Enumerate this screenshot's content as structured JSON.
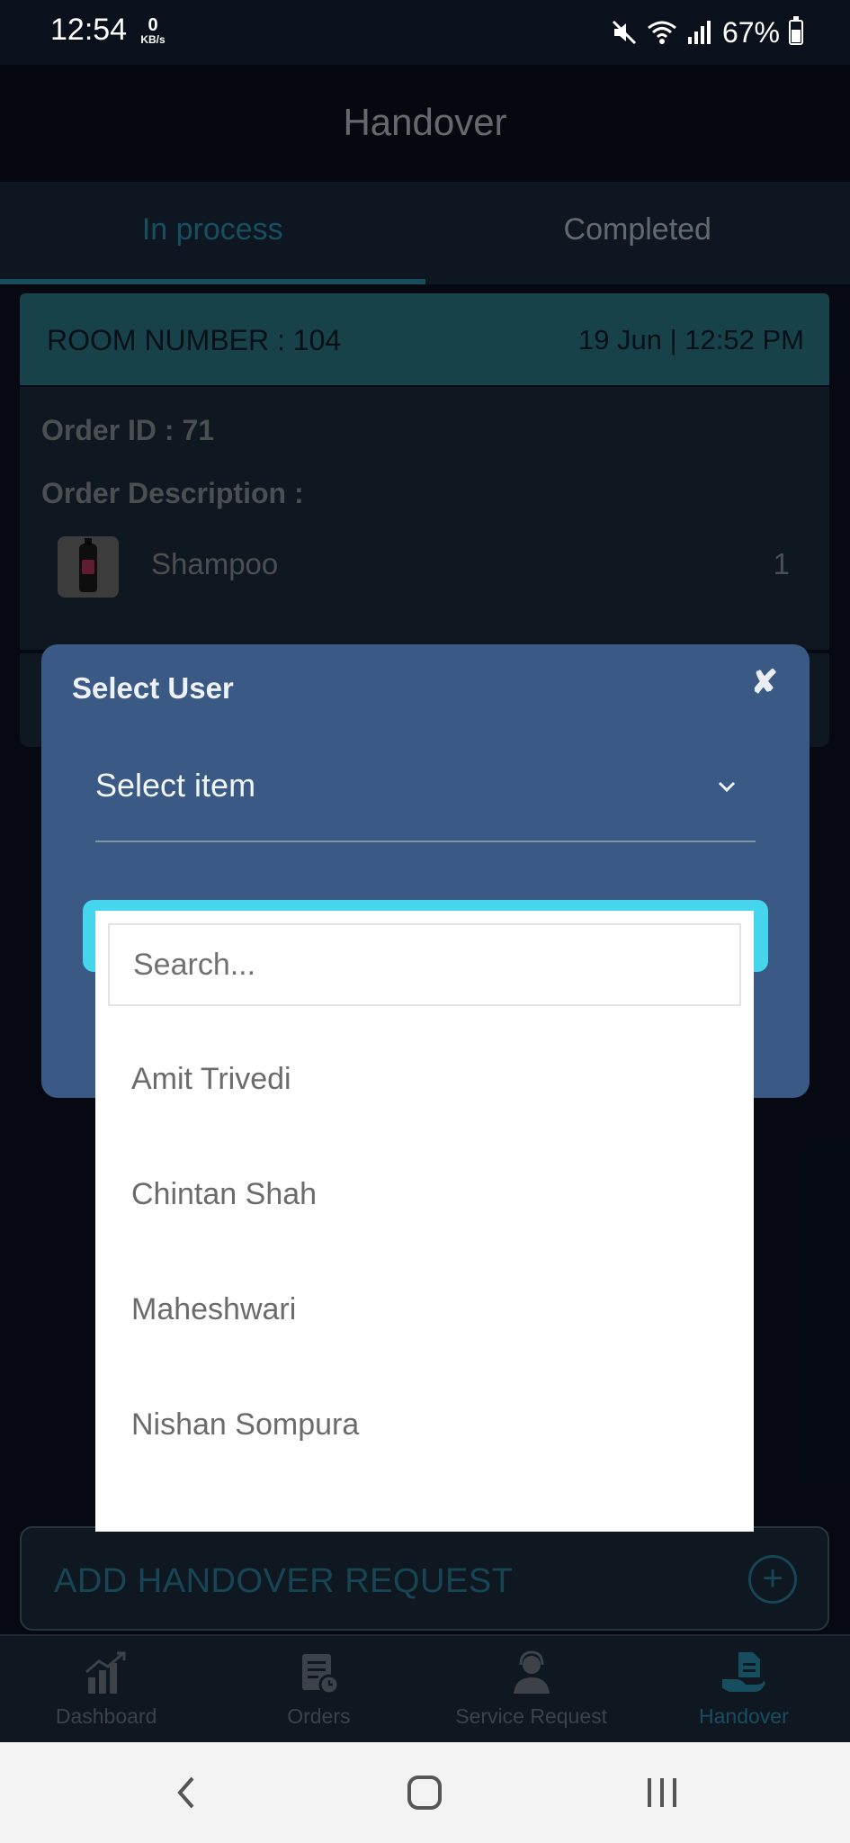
{
  "status_bar": {
    "time": "12:54",
    "net_speed_value": "0",
    "net_speed_unit": "KB/s",
    "battery_percent": "67%"
  },
  "header": {
    "title": "Handover"
  },
  "tabs": [
    {
      "label": "In process",
      "active": true
    },
    {
      "label": "Completed",
      "active": false
    }
  ],
  "card": {
    "room_number": "ROOM NUMBER : 104",
    "datetime": "19 Jun | 12:52 PM",
    "order_id": "Order ID : 71",
    "order_description_label": "Order Description :",
    "item_name": "Shampoo",
    "item_qty": "1"
  },
  "add_handover": {
    "label": "ADD HANDOVER REQUEST",
    "icon": "plus-circle-icon"
  },
  "bottom_nav": [
    {
      "label": "Dashboard",
      "icon": "bar-chart-icon",
      "active": false
    },
    {
      "label": "Orders",
      "icon": "orders-list-icon",
      "active": false
    },
    {
      "label": "Service Request",
      "icon": "headset-agent-icon",
      "active": false
    },
    {
      "label": "Handover",
      "icon": "hand-document-icon",
      "active": true
    }
  ],
  "dialog": {
    "title": "Select User",
    "select_placeholder": "Select item"
  },
  "dropdown": {
    "search_placeholder": "Search...",
    "options": [
      "Amit Trivedi",
      "Chintan Shah",
      "Maheshwari",
      "Nishan Sompura"
    ]
  },
  "colors": {
    "accent": "#2a8fae",
    "card_header": "#2a7987",
    "dialog_bg": "#3a5a85",
    "button_cyan": "#45d6ee"
  }
}
